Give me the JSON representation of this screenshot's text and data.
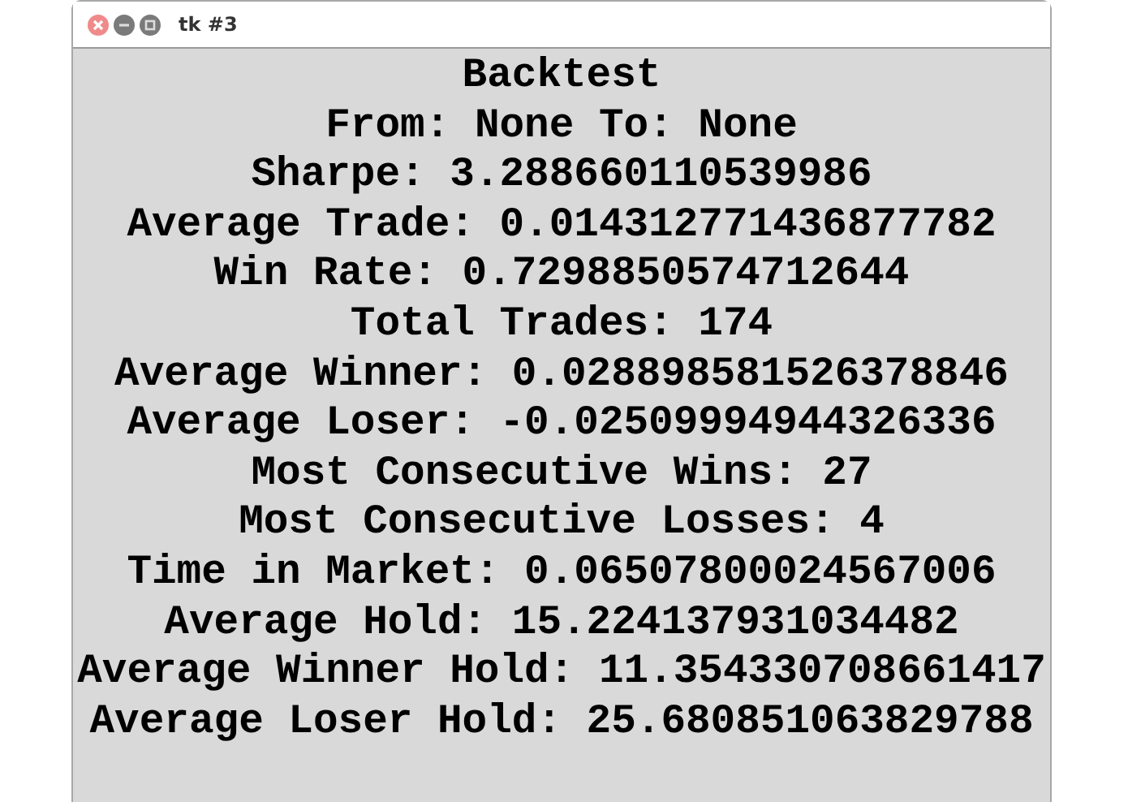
{
  "window": {
    "title": "tk #3"
  },
  "lines": [
    "Backtest",
    "From: None To: None",
    "Sharpe: 3.288660110539986",
    "Average Trade: 0.014312771436877782",
    "Win Rate: 0.7298850574712644",
    "Total Trades: 174",
    "Average Winner: 0.028898581526378846",
    "Average Loser: -0.02509994944326336",
    "Most Consecutive Wins: 27",
    "Most Consecutive Losses: 4",
    "Time in Market: 0.06507800024567006",
    "Average Hold: 15.224137931034482",
    "Average Winner Hold: 11.354330708661417",
    "Average Loser Hold: 25.680851063829788"
  ]
}
